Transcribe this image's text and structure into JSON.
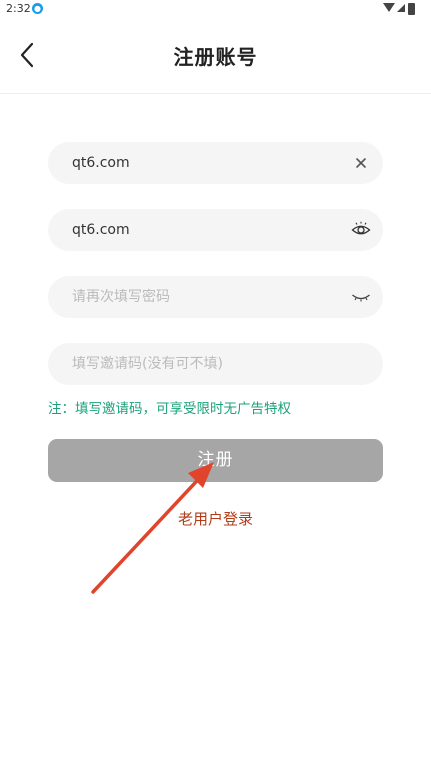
{
  "status_bar": {
    "time": "2:32",
    "app_icon": "app-notification-icon",
    "wifi_icon": "wifi-icon",
    "signal_icon": "signal-icon",
    "battery_icon": "battery-icon"
  },
  "header": {
    "back_icon": "chevron-left-icon",
    "title": "注册账号"
  },
  "form": {
    "account": {
      "value": "qt6.com",
      "placeholder": "",
      "action_icon": "clear-icon"
    },
    "password": {
      "value": "qt6.com",
      "placeholder": "",
      "action_icon": "eye-open-icon"
    },
    "confirm_password": {
      "value": "",
      "placeholder": "请再次填写密码",
      "action_icon": "eye-closed-icon"
    },
    "invite_code": {
      "value": "",
      "placeholder": "填写邀请码(没有可不填)"
    },
    "note": "注：填写邀请码，可享受限时无广告特权",
    "register_label": "注册",
    "login_link": "老用户登录"
  },
  "colors": {
    "field_bg": "#f5f5f5",
    "note": "#1aa37a",
    "button_disabled": "#a6a6a6",
    "login_link": "#b23c17",
    "annotation_arrow": "#e0442c"
  }
}
